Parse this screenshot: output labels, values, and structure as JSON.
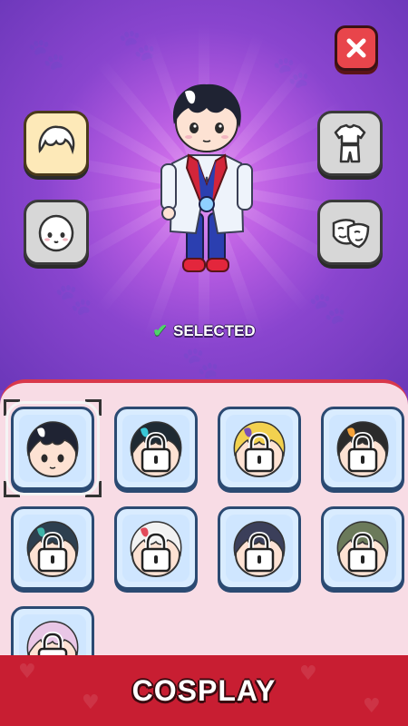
{
  "screen": {
    "title": "Cosplay"
  },
  "status": {
    "selected_label": "SELECTED"
  },
  "left_buttons": [
    {
      "name": "hair",
      "icon": "hair-icon"
    },
    {
      "name": "face",
      "icon": "face-icon"
    }
  ],
  "right_buttons": [
    {
      "name": "outfit",
      "icon": "outfit-icon"
    },
    {
      "name": "mask",
      "icon": "mask-icon"
    }
  ],
  "close": {
    "icon": "close-icon"
  },
  "skins": [
    {
      "id": "skin-1",
      "locked": false,
      "selected": true,
      "hair": "#1f2333",
      "accent": "#ffffff"
    },
    {
      "id": "skin-2",
      "locked": true,
      "selected": false,
      "hair": "#1f2a33",
      "accent": "#39c7d6"
    },
    {
      "id": "skin-3",
      "locked": true,
      "selected": false,
      "hair": "#f2d14f",
      "accent": "#7b4fb8"
    },
    {
      "id": "skin-4",
      "locked": true,
      "selected": false,
      "hair": "#2b2b2b",
      "accent": "#f5a23a"
    },
    {
      "id": "skin-5",
      "locked": true,
      "selected": false,
      "hair": "#2d3f4f",
      "accent": "#3fb3a8"
    },
    {
      "id": "skin-6",
      "locked": true,
      "selected": false,
      "hair": "#f2f2f2",
      "accent": "#e24a5a"
    },
    {
      "id": "skin-7",
      "locked": true,
      "selected": false,
      "hair": "#3b3f5a",
      "accent": "#3b3f5a"
    },
    {
      "id": "skin-8",
      "locked": true,
      "selected": false,
      "hair": "#6b7a5a",
      "accent": "#6b7a5a"
    },
    {
      "id": "skin-9",
      "locked": true,
      "selected": false,
      "hair": "#e9c7e6",
      "accent": "#e9c7e6"
    }
  ],
  "banner": {
    "label": "COSPLAY"
  },
  "colors": {
    "accent_red": "#c81e32",
    "panel_pink": "#f8dce5",
    "card_blue": "#d9ecff"
  }
}
